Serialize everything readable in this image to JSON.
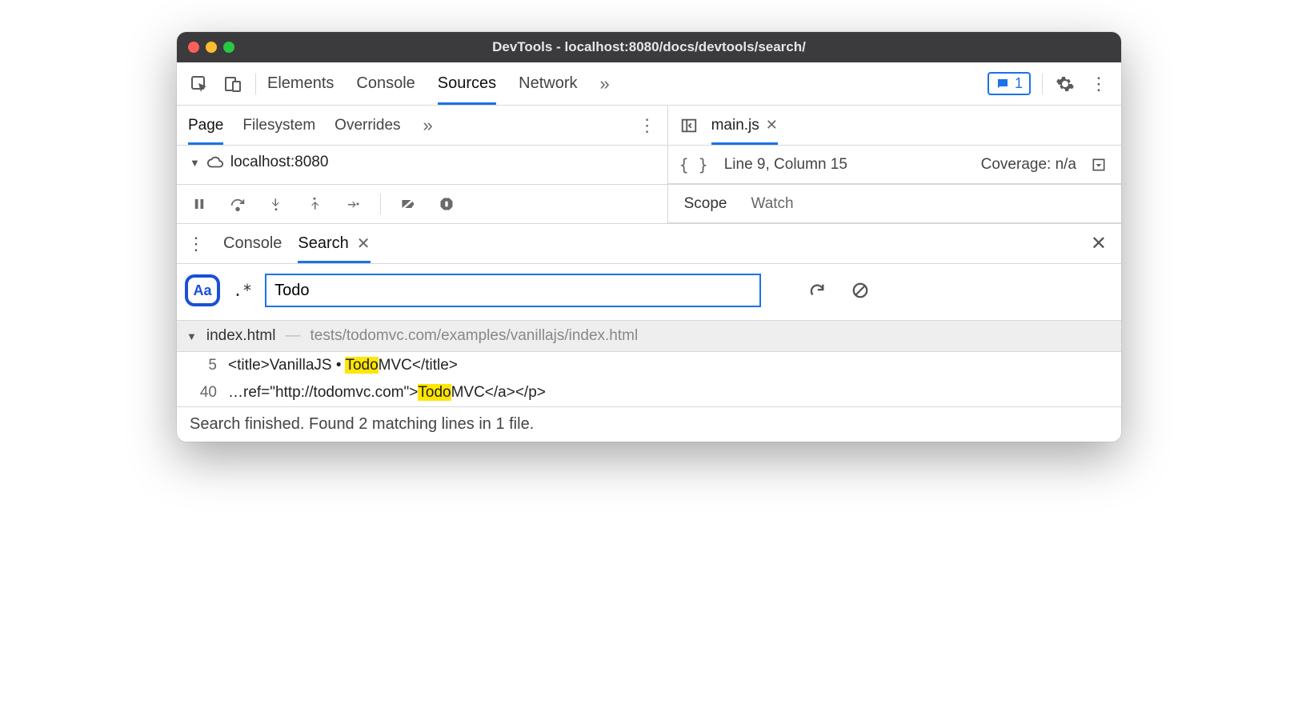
{
  "window": {
    "title": "DevTools - localhost:8080/docs/devtools/search/"
  },
  "toolbar": {
    "tabs": [
      "Elements",
      "Console",
      "Sources",
      "Network"
    ],
    "active_tab": "Sources",
    "overflow": "»",
    "feedback_count": "1"
  },
  "left_pane": {
    "subtabs": [
      "Page",
      "Filesystem",
      "Overrides"
    ],
    "active": "Page",
    "overflow": "»",
    "tree_root": "localhost:8080"
  },
  "right_pane": {
    "open_file": "main.js",
    "cursor": "Line 9, Column 15",
    "coverage": "Coverage: n/a",
    "scope_tabs": [
      "Scope",
      "Watch"
    ]
  },
  "drawer": {
    "tabs": [
      "Console",
      "Search"
    ],
    "active": "Search",
    "case_label": "Aa",
    "regex_label": ".*",
    "query": "Todo"
  },
  "results": {
    "file": {
      "name": "index.html",
      "path": "tests/todomvc.com/examples/vanillajs/index.html"
    },
    "lines": [
      {
        "num": "5",
        "pre": "<title>VanillaJS • ",
        "match": "Todo",
        "post": "MVC</title>"
      },
      {
        "num": "40",
        "pre": "…ref=\"http://todomvc.com\">",
        "match": "Todo",
        "post": "MVC</a></p>"
      }
    ]
  },
  "footer": {
    "status": "Search finished.  Found 2 matching lines in 1 file."
  }
}
